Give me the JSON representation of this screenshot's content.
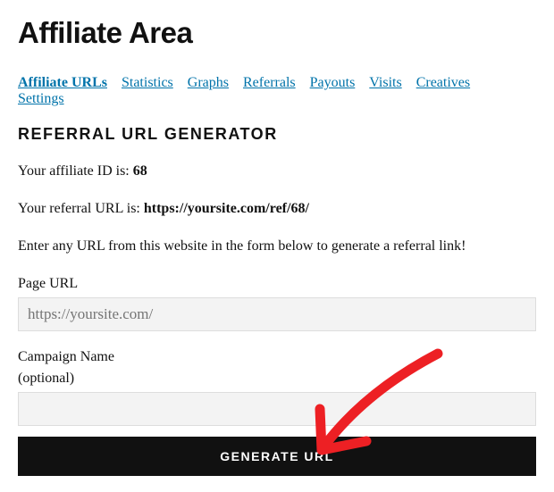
{
  "header": {
    "title": "Affiliate Area"
  },
  "tabs": [
    {
      "label": "Affiliate URLs",
      "active": true
    },
    {
      "label": "Statistics",
      "active": false
    },
    {
      "label": "Graphs",
      "active": false
    },
    {
      "label": "Referrals",
      "active": false
    },
    {
      "label": "Payouts",
      "active": false
    },
    {
      "label": "Visits",
      "active": false
    },
    {
      "label": "Creatives",
      "active": false
    },
    {
      "label": "Settings",
      "active": false
    }
  ],
  "generator": {
    "section_title": "REFERRAL URL GENERATOR",
    "affiliate_id_label": "Your affiliate ID is: ",
    "affiliate_id": "68",
    "referral_url_label": "Your referral URL is: ",
    "referral_url": "https://yoursite.com/ref/68/",
    "instruction": "Enter any URL from this website in the form below to generate a referral link!",
    "page_url_label": "Page URL",
    "page_url_placeholder": "https://yoursite.com/",
    "campaign_label": "Campaign Name",
    "campaign_sub": "(optional)",
    "campaign_value": "",
    "button_label": "GENERATE URL"
  },
  "annotation": {
    "arrow_color": "#ed2024"
  }
}
